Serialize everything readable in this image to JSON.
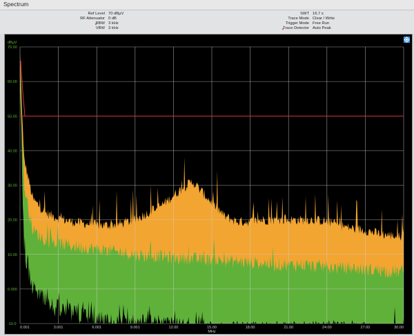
{
  "app": {
    "title": "Spectrum"
  },
  "settings": {
    "left": [
      {
        "label": "Ref Level",
        "value": "70 dBµV",
        "marked": false
      },
      {
        "label": "RF Attenuator",
        "value": "0 dB",
        "marked": false
      },
      {
        "label": "RBW",
        "value": "3 kHz",
        "marked": true
      },
      {
        "label": "VBW",
        "value": "3 kHz",
        "marked": false
      }
    ],
    "right": [
      {
        "label": "SWT",
        "value": "16.7 s",
        "marked": false
      },
      {
        "label": "Trace Mode",
        "value": "Clear / Write",
        "marked": false
      },
      {
        "label": "Trigger Mode",
        "value": "Free Run",
        "marked": false
      },
      {
        "label": "Trace Detector",
        "value": "Auto Peak",
        "marked": true
      }
    ],
    "marker_color": "#d8324a"
  },
  "icons": {
    "corner": "rs-diamond-icon"
  },
  "chart_data": {
    "type": "area",
    "xlabel": "MHz",
    "ylabel": "dBµV",
    "xlim": [
      0.001,
      30.0
    ],
    "ylim": [
      -10,
      70
    ],
    "x_ticks": [
      "0.001",
      "3.001",
      "6.001",
      "9.001",
      "12.00",
      "15.00",
      "18.00",
      "21.00",
      "24.00",
      "27.00",
      "30.00"
    ],
    "y_ticks": [
      "70.00",
      "60.00",
      "50.00",
      "40.00",
      "30.00",
      "20.00",
      "10.00",
      "0.000",
      "-10.0",
      "-20.0",
      "-30.0",
      "-40.0"
    ],
    "grid": true,
    "limit_line": {
      "value": 50,
      "color": "#e0303a"
    },
    "colors": {
      "peak": "#f2a531",
      "average": "#5fb13a",
      "grid": "#cfcfcf",
      "tick_label": "#62b736"
    },
    "series": [
      {
        "x": [
          0.001,
          0.3,
          1,
          2,
          3,
          4,
          5,
          6,
          7,
          8,
          9,
          10,
          11,
          12,
          13,
          13.5,
          14,
          15,
          16,
          17,
          18,
          19,
          20,
          21,
          22,
          23,
          24,
          25,
          26,
          27,
          28,
          29,
          30
        ],
        "values": [
          68,
          38,
          26,
          22,
          20.5,
          19.5,
          19,
          18.5,
          18.5,
          19,
          20,
          22,
          24,
          27,
          30,
          31,
          29,
          25,
          21,
          19.5,
          19.5,
          20,
          20,
          20,
          20,
          20,
          19.5,
          18.5,
          17.5,
          17,
          16,
          15.5,
          15
        ]
      },
      {
        "x": [
          0.001,
          0.3,
          1,
          2,
          3,
          4,
          5,
          6,
          7,
          8,
          9,
          10,
          11,
          12,
          13,
          14,
          15,
          16,
          17,
          18,
          19,
          20,
          21,
          22,
          23,
          24,
          25,
          26,
          27,
          28,
          29,
          30
        ],
        "values": [
          64,
          30,
          17,
          14,
          13,
          12.5,
          12,
          11.5,
          11,
          10.5,
          10,
          9.5,
          9.5,
          9,
          9,
          8.5,
          8.5,
          8,
          8,
          7.5,
          7.5,
          7,
          7,
          7,
          6.5,
          6.5,
          6,
          6,
          5.5,
          5.5,
          5,
          5
        ]
      },
      {
        "x": [
          0.001,
          0.3,
          1,
          2,
          3,
          4,
          5,
          6,
          7,
          8,
          9,
          10,
          11,
          12,
          13,
          14,
          15,
          16,
          17,
          18,
          19,
          20,
          21,
          22,
          23,
          24,
          25,
          26,
          27,
          28,
          29,
          30
        ],
        "values": [
          60,
          12,
          0,
          -4,
          -6,
          -7,
          -8,
          -9,
          -10,
          -10,
          -10,
          -10,
          -11,
          -11,
          -11,
          -11,
          -12,
          -12,
          -12,
          -12,
          -12,
          -12,
          -12,
          -12,
          -12,
          -12,
          -12,
          -12,
          -12,
          -13,
          -13,
          -13
        ]
      }
    ]
  }
}
